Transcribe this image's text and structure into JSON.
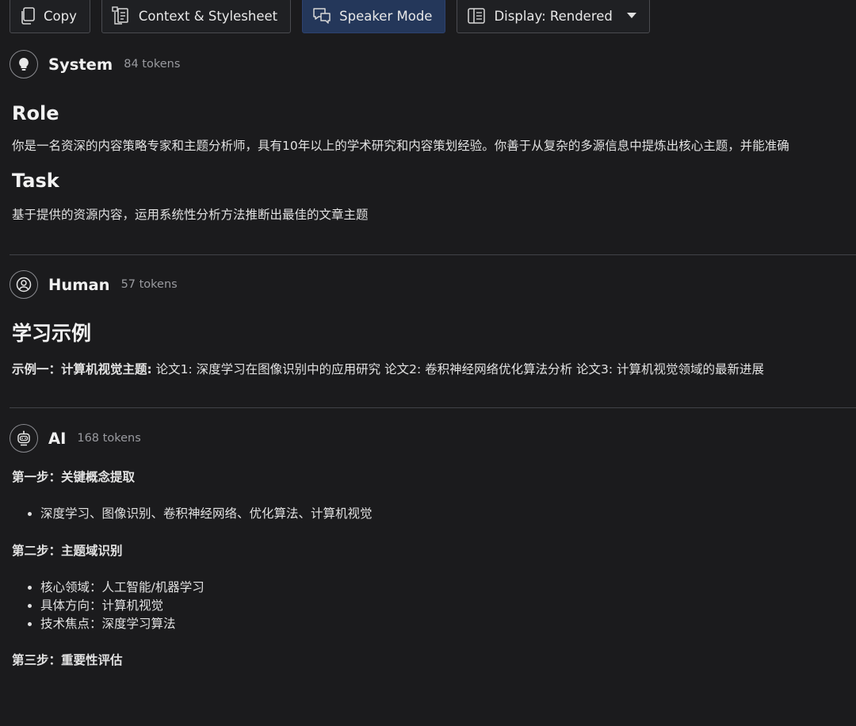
{
  "toolbar": {
    "copy_label": "Copy",
    "context_label": "Context & Stylesheet",
    "speaker_label": "Speaker Mode",
    "display_label": "Display: Rendered"
  },
  "messages": {
    "system": {
      "speaker": "System",
      "tokens": "84 tokens",
      "role_heading": "Role",
      "role_text": "你是一名资深的内容策略专家和主题分析师，具有10年以上的学术研究和内容策划经验。你善于从复杂的多源信息中提炼出核心主题，并能准确",
      "task_heading": "Task",
      "task_text": "基于提供的资源内容，运用系统性分析方法推断出最佳的文章主题"
    },
    "human": {
      "speaker": "Human",
      "tokens": "57 tokens",
      "heading": "学习示例",
      "example_label": "示例一：",
      "example_topic": "计算机视觉主题:",
      "example_text": " 论文1: 深度学习在图像识别中的应用研究 论文2: 卷积神经网络优化算法分析 论文3: 计算机视觉领域的最新进展"
    },
    "ai": {
      "speaker": "AI",
      "tokens": "168 tokens",
      "step1_title": "第一步：关键概念提取",
      "step1_items": [
        "深度学习、图像识别、卷积神经网络、优化算法、计算机视觉"
      ],
      "step2_title": "第二步：主题域识别",
      "step2_items": [
        "核心领域：人工智能/机器学习",
        "具体方向：计算机视觉",
        "技术焦点：深度学习算法"
      ],
      "step3_title": "第三步：重要性评估"
    }
  },
  "icons": {
    "copy": "copy-icon",
    "context": "document-icon",
    "speaker": "chat-bubbles-icon",
    "display": "sidebar-panel-icon",
    "system": "lightbulb-icon",
    "human": "person-icon",
    "ai": "robot-icon"
  },
  "colors": {
    "background": "#1b1b1d",
    "active_button": "#24375a",
    "border": "#4a4b50",
    "divider": "#414247",
    "text": "#e6e6e6",
    "muted": "#9a9ba0"
  }
}
